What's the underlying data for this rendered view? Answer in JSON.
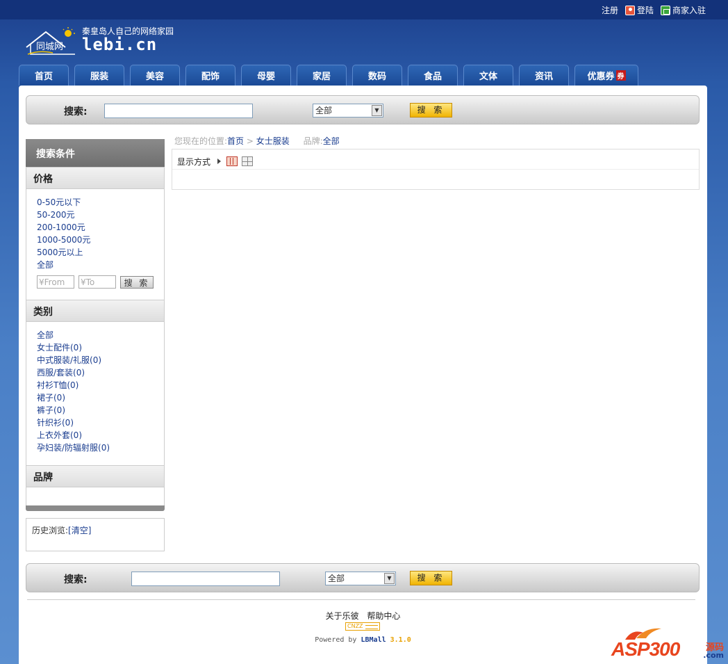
{
  "topbar": {
    "register": "注册",
    "login": "登陆",
    "merchant": "商家入驻"
  },
  "logo": {
    "slogan": "秦皇岛人自己的网络家园",
    "domain": "lebi.cn",
    "city": "同城网"
  },
  "nav": [
    {
      "label": "首页"
    },
    {
      "label": "服装"
    },
    {
      "label": "美容"
    },
    {
      "label": "配饰"
    },
    {
      "label": "母婴"
    },
    {
      "label": "家居"
    },
    {
      "label": "数码"
    },
    {
      "label": "食品"
    },
    {
      "label": "文体"
    },
    {
      "label": "资讯"
    },
    {
      "label": "优惠券",
      "badge": "券"
    }
  ],
  "search_top": {
    "label": "搜索:",
    "keyword": "",
    "select_value": "全部",
    "button": "搜 索"
  },
  "search_bottom": {
    "label": "搜索:",
    "keyword": "",
    "select_value": "全部",
    "button": "搜 索"
  },
  "sidebar": {
    "header": "搜索条件",
    "price": {
      "title": "价格",
      "items": [
        "0-50元以下",
        "50-200元",
        "200-1000元",
        "1000-5000元",
        "5000元以上",
        "全部"
      ],
      "from_placeholder": "¥From",
      "to_placeholder": "¥To",
      "button": "搜 索"
    },
    "category": {
      "title": "类别",
      "items": [
        "全部",
        "女士配件(0)",
        "中式服装/礼服(0)",
        "西服/套装(0)",
        "衬衫T恤(0)",
        "裙子(0)",
        "裤子(0)",
        "针织衫(0)",
        "上衣外套(0)",
        "孕妇装/防辐射服(0)"
      ]
    },
    "brand": {
      "title": "品牌"
    },
    "history": {
      "label": "历史浏览:",
      "clear": "[清空]"
    }
  },
  "breadcrumb": {
    "prefix": "您现在的位置:",
    "home": "首页",
    "sep": ">",
    "current": "女士服装",
    "brand_label": "品牌:",
    "brand_value": "全部"
  },
  "display": {
    "label": "显示方式"
  },
  "footer": {
    "links": [
      "关于乐彼",
      "帮助中心"
    ],
    "cnzz": "CNZZ",
    "powered_by": "Powered by",
    "brand": "LBMall",
    "version": "3.1.0"
  },
  "watermark": {
    "text": "ASP300",
    "side": "源码",
    "domain": ".com"
  },
  "colors": {
    "accent": "#1c3f8c",
    "button": "#f0b400",
    "coupon": "#c71a1a"
  }
}
